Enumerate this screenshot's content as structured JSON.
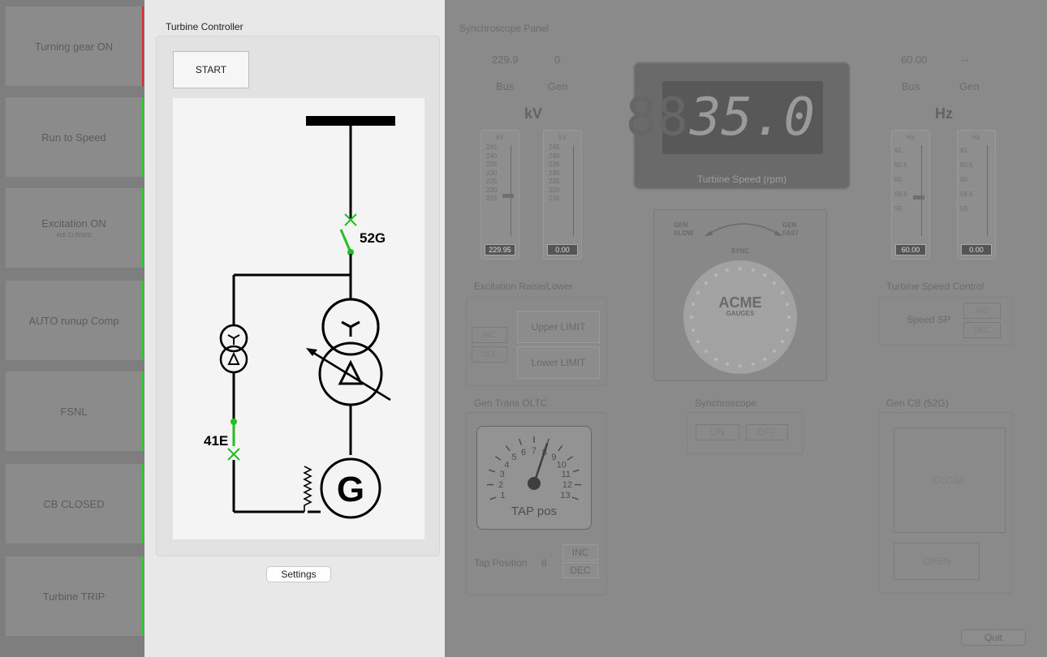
{
  "sidebar": {
    "steps": [
      {
        "label": "Turning gear ON",
        "sub": ""
      },
      {
        "label": "Run to Speed",
        "sub": ""
      },
      {
        "label": "Excitation ON",
        "sub": "41E CLOSED"
      },
      {
        "label": "AUTO runup Comp",
        "sub": ""
      },
      {
        "label": "FSNL",
        "sub": ""
      },
      {
        "label": "CB CLOSED",
        "sub": ""
      },
      {
        "label": "Turbine TRIP",
        "sub": ""
      }
    ]
  },
  "turbine_controller": {
    "title": "Turbine Controller",
    "start_label": "START",
    "settings_label": "Settings",
    "diagram": {
      "breaker_52g": "52G",
      "breaker_41e": "41E",
      "generator": "G",
      "closed_color": "#22c022"
    }
  },
  "synchroscope_panel": {
    "title": "Synchroscope Panel",
    "kv": {
      "bus_value": "229.9",
      "gen_value": "0",
      "bus_label": "Bus",
      "gen_label": "Gen",
      "unit": "kV",
      "meter_unit": "kV",
      "ticks": [
        "245",
        "240",
        "235",
        "230",
        "225",
        "220",
        "215"
      ],
      "bus_readout": "229.95",
      "gen_readout": "0.00"
    },
    "hz": {
      "bus_value": "60.00",
      "gen_value": "--",
      "bus_label": "Bus",
      "gen_label": "Gen",
      "unit": "Hz",
      "meter_unit": "Hz",
      "ticks": [
        "61",
        "60.5",
        "60",
        "59.5",
        "59"
      ],
      "bus_readout": "60.00",
      "gen_readout": "0.00"
    },
    "speed_display": {
      "value": "35.0",
      "dim_digits": "88",
      "caption": "Turbine Speed (rpm)"
    },
    "synchroscope_gauge": {
      "slow": "GEN\nSLOW",
      "fast": "GEN\nFAST",
      "sync": "SYNC",
      "brand": "ACME",
      "brand_sub": "GAUGES"
    },
    "excitation": {
      "title": "Excitation Raise/Lower",
      "inc": "INC",
      "dec": "DEC",
      "upper": "Upper LIMIT",
      "lower": "Lower LIMIT"
    },
    "speed_control": {
      "title": "Turbine Speed Control",
      "label": "Speed SP",
      "inc": "INC",
      "dec": "DEC"
    },
    "oltc": {
      "title": "Gen Trans OLTC",
      "dial_numbers": [
        "1",
        "2",
        "3",
        "4",
        "5",
        "6",
        "7",
        "8",
        "9",
        "10",
        "11",
        "12",
        "13"
      ],
      "dial_caption": "TAP pos",
      "tap_label": "Tap Position",
      "tap_value": "8",
      "inc": "INC",
      "dec": "DEC",
      "tap_fraction": 0.583
    },
    "synchroscope": {
      "title": "Synchroscope",
      "on": "ON",
      "off": "OFF"
    },
    "gen_cb": {
      "title": "Gen CB (52G)",
      "close": "CLOSE",
      "open": "OPEN"
    },
    "quit_label": "Quit"
  }
}
